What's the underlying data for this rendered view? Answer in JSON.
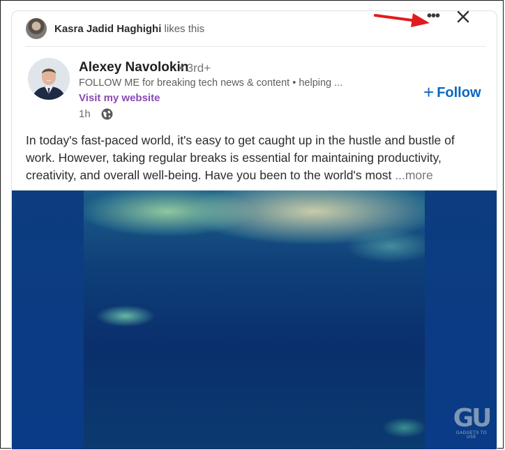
{
  "social": {
    "actor": "Kasra Jadid Haghighi",
    "action": "likes this"
  },
  "post": {
    "author_name": "Alexey Navolokin",
    "degree": "• 3rd+",
    "headline": "FOLLOW ME for breaking tech news & content • helping ...",
    "website_link": "Visit my website",
    "time": "1h",
    "follow_label": "Follow",
    "follow_plus": "+",
    "body": "In today's fast-paced world, it's easy to get caught up in the hustle and bustle of work. However, taking regular breaks is essential for maintaining productivity, creativity, and overall well-being. Have you been to the world's most",
    "more_label": "...more"
  },
  "controls": {
    "more_dots": "•••",
    "close": "✕"
  },
  "watermark": {
    "logo": "GU",
    "tagline": "GADGETS TO USE"
  },
  "colors": {
    "follow": "#0a66c2",
    "website": "#8a4ab4",
    "arrow": "#e21c1c"
  }
}
